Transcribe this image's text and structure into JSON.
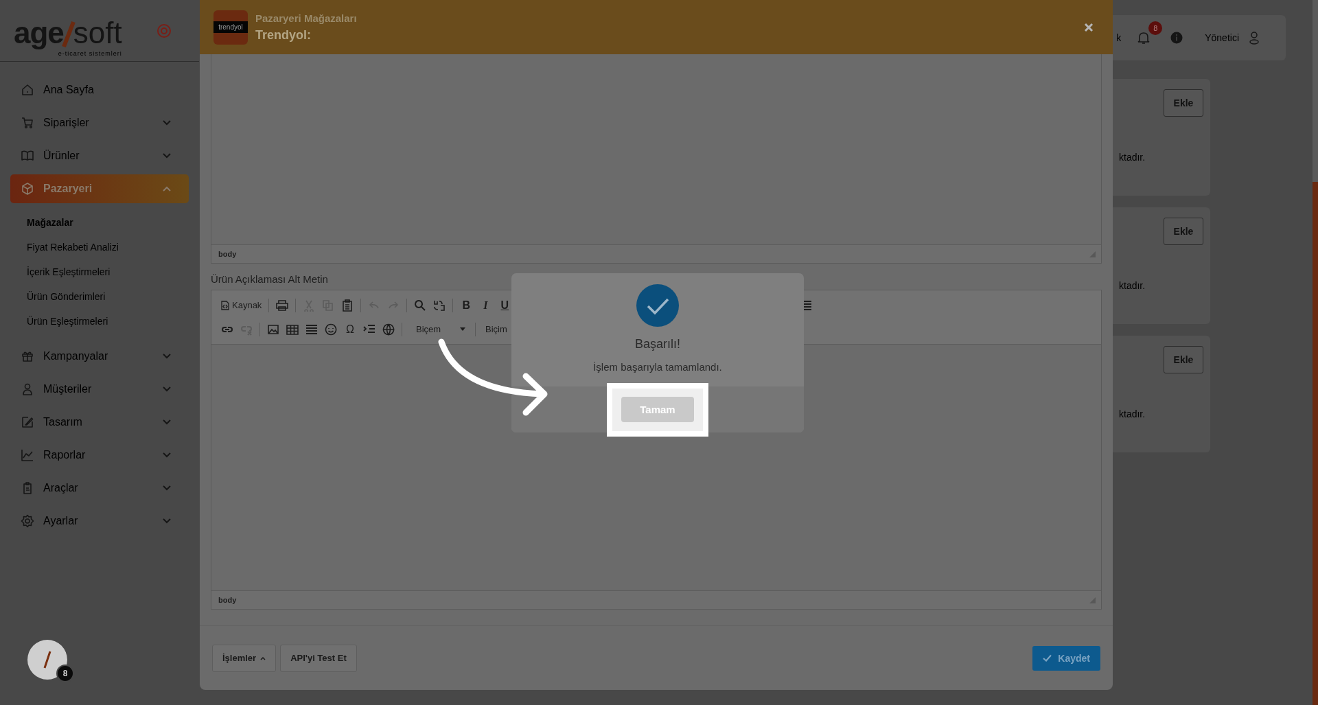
{
  "sidebar": {
    "logo": {
      "left": "age",
      "right": "soft",
      "tagline": "e-ticaret sistemleri"
    },
    "items": [
      {
        "label": "Ana Sayfa",
        "selected": false
      },
      {
        "label": "Siparişler",
        "selected": false,
        "expanded": false
      },
      {
        "label": "Ürünler",
        "selected": false,
        "expanded": false
      },
      {
        "label": "Pazaryeri",
        "selected": true,
        "expanded": true,
        "children": [
          {
            "label": "Mağazalar",
            "selected": true
          },
          {
            "label": "Fiyat Rekabeti Analizi",
            "selected": false
          },
          {
            "label": "İçerik Eşleştirmeleri",
            "selected": false
          },
          {
            "label": "Ürün Gönderimleri",
            "selected": false
          },
          {
            "label": "Ürün Eşleştirmeleri",
            "selected": false
          }
        ]
      },
      {
        "label": "Kampanyalar",
        "selected": false,
        "expanded": false
      },
      {
        "label": "Müşteriler",
        "selected": false,
        "expanded": false
      },
      {
        "label": "Tasarım",
        "selected": false,
        "expanded": false
      },
      {
        "label": "Raporlar",
        "selected": false,
        "expanded": false
      },
      {
        "label": "Araçlar",
        "selected": false,
        "expanded": false
      },
      {
        "label": "Ayarlar",
        "selected": false,
        "expanded": false
      }
    ]
  },
  "topbar": {
    "cut_text": "k",
    "notification_count": "8",
    "user": "Yönetici"
  },
  "cards": [
    {
      "button": "Ekle",
      "text": "ktadır."
    },
    {
      "button": "Ekle",
      "text": "ktadır."
    },
    {
      "button": "Ekle",
      "text": "ktadır."
    }
  ],
  "help_button": {
    "badge": "8"
  },
  "modal": {
    "logo_text": "trendyol",
    "subtitle": "Pazaryeri Mağazaları",
    "title": "Trendyol:",
    "editors": [
      {
        "status": "body"
      },
      {
        "label": "Ürün Açıklaması Alt Metin",
        "status": "body",
        "toolbar": [
          [
            {
              "kind": "source",
              "label": "Kaynak",
              "disabled": false
            },
            {
              "kind": "separator"
            },
            {
              "kind": "print",
              "disabled": false
            },
            {
              "kind": "separator"
            },
            {
              "kind": "cut",
              "disabled": true
            },
            {
              "kind": "copy",
              "disabled": true
            },
            {
              "kind": "paste",
              "disabled": false
            },
            {
              "kind": "separator"
            },
            {
              "kind": "undo",
              "disabled": true
            },
            {
              "kind": "redo",
              "disabled": true
            },
            {
              "kind": "separator"
            },
            {
              "kind": "find",
              "disabled": false
            },
            {
              "kind": "replace",
              "disabled": false
            },
            {
              "kind": "separator"
            },
            {
              "kind": "bold",
              "label": "B",
              "disabled": false
            },
            {
              "kind": "italic",
              "label": "I",
              "disabled": false
            },
            {
              "kind": "underline",
              "label": "U",
              "disabled": false
            },
            {
              "kind": "justify",
              "disabled": false
            }
          ],
          [
            {
              "kind": "link",
              "disabled": false
            },
            {
              "kind": "unlink",
              "disabled": true
            },
            {
              "kind": "separator"
            },
            {
              "kind": "image",
              "disabled": false
            },
            {
              "kind": "table",
              "disabled": false
            },
            {
              "kind": "rule",
              "disabled": false
            },
            {
              "kind": "smiley",
              "disabled": false
            },
            {
              "kind": "symbol",
              "label": "Ω",
              "disabled": false
            },
            {
              "kind": "indent",
              "disabled": false
            },
            {
              "kind": "globe",
              "disabled": false
            },
            {
              "kind": "separator"
            },
            {
              "kind": "select",
              "label": "Biçem",
              "disabled": false
            },
            {
              "kind": "separator"
            },
            {
              "kind": "plain",
              "label": "Biçim",
              "disabled": false
            }
          ]
        ]
      }
    ],
    "footer_buttons": [
      {
        "label": "İşlemler",
        "kind": "menu"
      },
      {
        "label": "API'yi Test Et",
        "kind": "plain"
      }
    ],
    "save_button": "Kaydet"
  },
  "alert": {
    "title": "Başarılı!",
    "message": "İşlem başarıyla tamamlandı.",
    "button": "Tamam"
  }
}
